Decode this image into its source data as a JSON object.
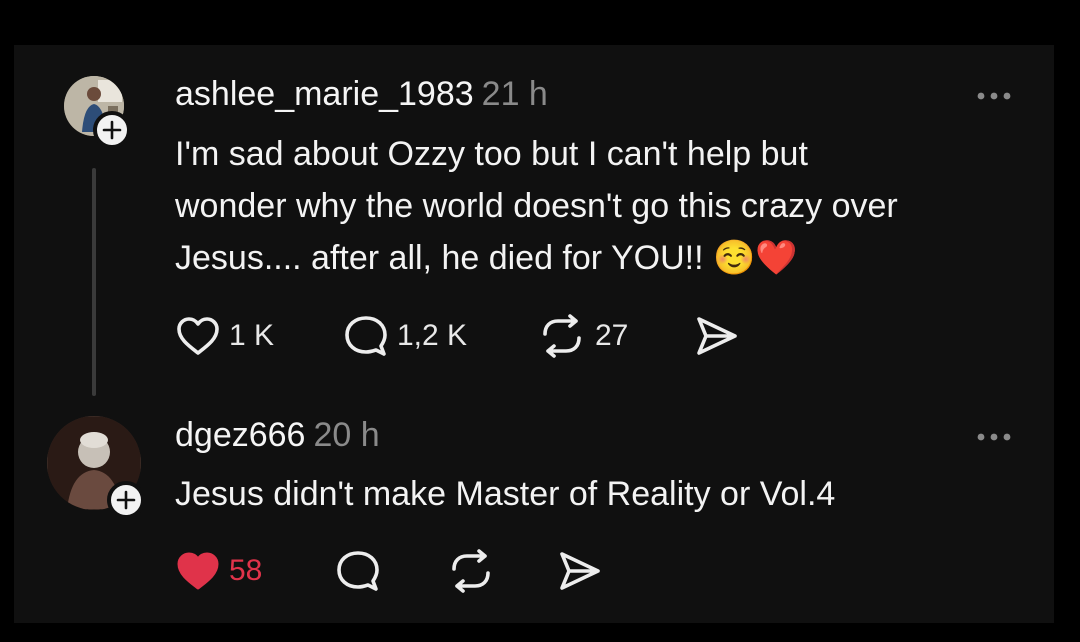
{
  "comments": [
    {
      "username": "ashlee_marie_1983",
      "time": "21 h",
      "text": "I'm sad about Ozzy too but I can't help but\nwonder why the world doesn't go this crazy over\nJesus.... after all, he died for YOU!! ☺️❤️",
      "likes": "1 K",
      "replies": "1,2 K",
      "reposts": "27",
      "liked": false
    },
    {
      "username": "dgez666",
      "time": "20 h",
      "text": "Jesus didn't make Master of Reality or Vol.4",
      "likes": "58",
      "replies": "",
      "reposts": "",
      "liked": true
    }
  ],
  "colors": {
    "background": "#101010",
    "text": "#f3f3f3",
    "muted": "#8a8a8a",
    "liked": "#e0334a"
  },
  "icons": [
    "heart-icon",
    "comment-icon",
    "repost-icon",
    "share-icon",
    "more-icon",
    "plus-icon"
  ]
}
